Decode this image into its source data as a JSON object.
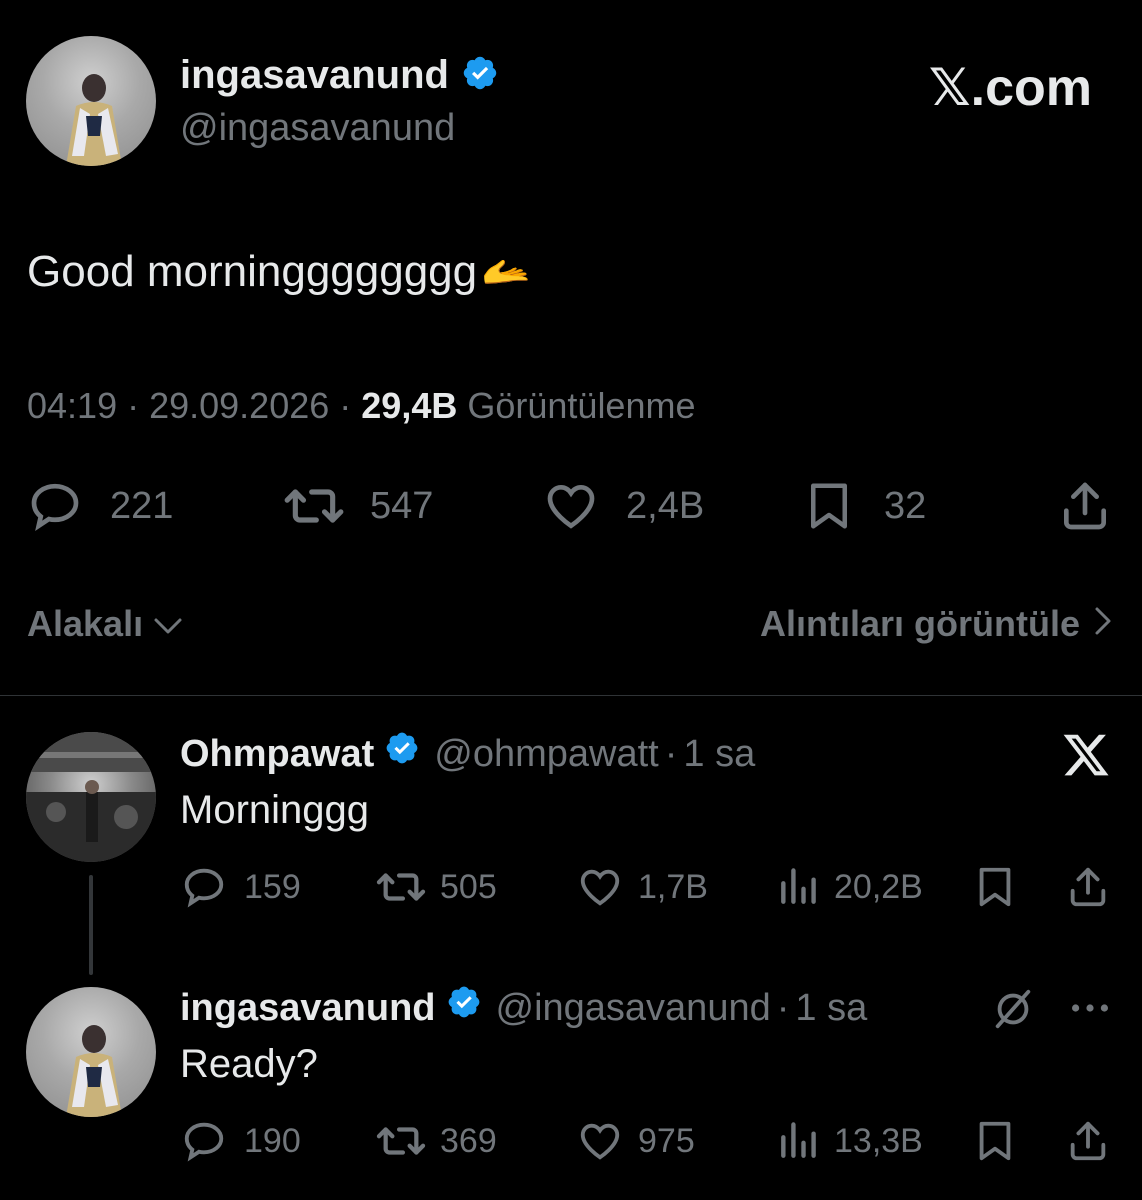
{
  "main_tweet": {
    "display_name": "ingasavanund",
    "handle": "@ingasavanund",
    "text": "Good morningggggggg",
    "emoji": "🫴",
    "time": "04:19",
    "sep1": "·",
    "date": "29.09.2026",
    "sep2": "·",
    "views_count": "29,4B",
    "views_label": "Görüntülenme",
    "replies": "221",
    "retweets": "547",
    "likes": "2,4B",
    "bookmarks": "32"
  },
  "brand": {
    "logo_text": "𝕏.com"
  },
  "sort_bar": {
    "sort_label": "Alakalı",
    "quotes_label": "Alıntıları görüntüle"
  },
  "replies": [
    {
      "display_name": "Ohmpawat",
      "handle": "@ohmpawatt",
      "sep": "·",
      "time": "1 sa",
      "text": "Morninggg",
      "replies": "159",
      "retweets": "505",
      "likes": "1,7B",
      "views": "20,2B"
    },
    {
      "display_name": "ingasavanund",
      "handle": "@ingasavanund",
      "sep": "·",
      "time": "1 sa",
      "text": "Ready?",
      "replies": "190",
      "retweets": "369",
      "likes": "975",
      "views": "13,3B"
    }
  ],
  "colors": {
    "background": "#000000",
    "text": "#e7e9ea",
    "muted": "#71767b",
    "verified": "#1d9bf0"
  }
}
